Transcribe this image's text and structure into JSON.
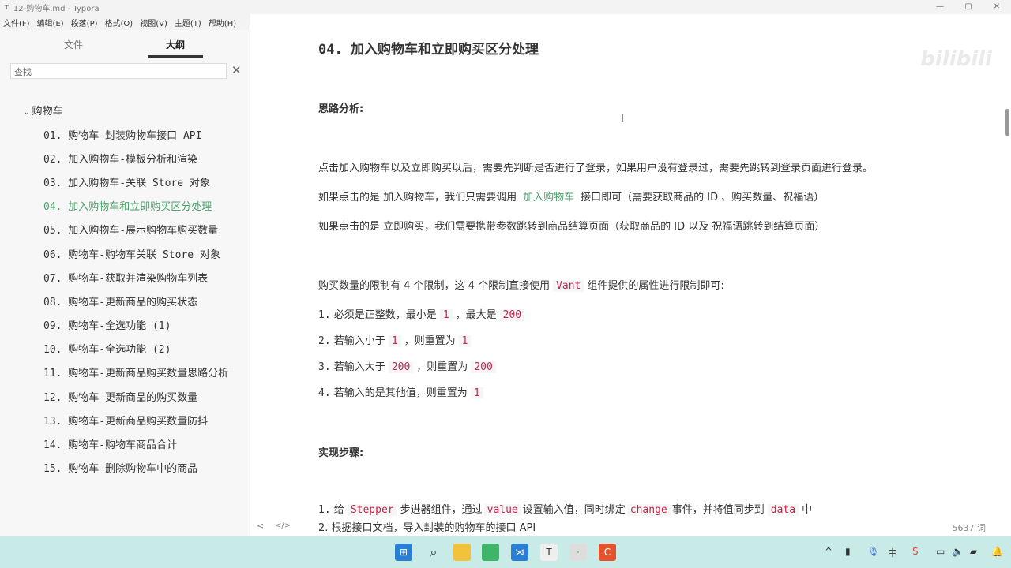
{
  "window": {
    "title": "12-购物车.md - Typora",
    "app_icon": "T",
    "min": "—",
    "max": "▢",
    "close": "✕"
  },
  "menu": [
    "文件(F)",
    "编辑(E)",
    "段落(P)",
    "格式(O)",
    "视图(V)",
    "主题(T)",
    "帮助(H)"
  ],
  "sidebar": {
    "tabs": [
      "文件",
      "大纲"
    ],
    "search_placeholder": "查找",
    "root": "购物车",
    "items": [
      "01. 购物车-封装购物车接口 API",
      "02. 加入购物车-模板分析和渲染",
      "03. 加入购物车-关联 Store 对象",
      "04. 加入购物车和立即购买区分处理",
      "05. 加入购物车-展示购物车购买数量",
      "06. 购物车-购物车关联 Store 对象",
      "07. 购物车-获取并渲染购物车列表",
      "08. 购物车-更新商品的购买状态",
      "09. 购物车-全选功能 (1)",
      "10. 购物车-全选功能 (2)",
      "11. 购物车-更新商品购买数量思路分析",
      "12. 购物车-更新商品的购买数量",
      "13. 购物车-更新商品购买数量防抖",
      "14. 购物车-购物车商品合计",
      "15. 购物车-删除购物车中的商品"
    ]
  },
  "doc": {
    "title": "04. 加入购物车和立即购买区分处理",
    "h_analysis": "思路分析:",
    "p1": "点击加入购物车以及立即购买以后，需要先判断是否进行了登录，如果用户没有登录过，需要先跳转到登录页面进行登录。",
    "p2a": "如果点击的是 加入购物车，我们只需要调用",
    "p2b": "加入购物车",
    "p2c": "接口即可（需要获取商品的 ID 、购买数量、祝福语）",
    "p3": "如果点击的是 立即购买，我们需要携带参数跳转到商品结算页面（获取商品的 ID 以及 祝福语跳转到结算页面）",
    "p4a": "购买数量的限制有 4 个限制，这 4 个限制直接使用",
    "p4b": "Vant",
    "p4c": "组件提供的属性进行限制即可:",
    "list": [
      {
        "n": "1.",
        "a": "必须是正整数，最小是",
        "b": "1",
        "c": "，最大是",
        "d": "200"
      },
      {
        "n": "2.",
        "a": "若输入小于",
        "b": "1",
        "c": "，则重置为",
        "d": "1"
      },
      {
        "n": "3.",
        "a": "若输入大于",
        "b": "200",
        "c": "，则重置为",
        "d": "200"
      },
      {
        "n": "4.",
        "a": "若输入的是其他值，则重置为",
        "b": "1",
        "c": "",
        "d": ""
      }
    ],
    "h_steps": "实现步骤:",
    "s1": {
      "n": "1.",
      "a": "给",
      "b": "Stepper",
      "c": "步进器组件，通过",
      "d": "value",
      "e": "设置输入值，同时绑定",
      "f": "change",
      "g": "事件，并将值同步到",
      "h": "data",
      "i": "中"
    },
    "s2": "2. 根据接口文档，导入封装的购物车的接口 API"
  },
  "status": {
    "back": "<",
    "source": "</>",
    "words": "5637 词"
  },
  "watermark": "bilibili"
}
